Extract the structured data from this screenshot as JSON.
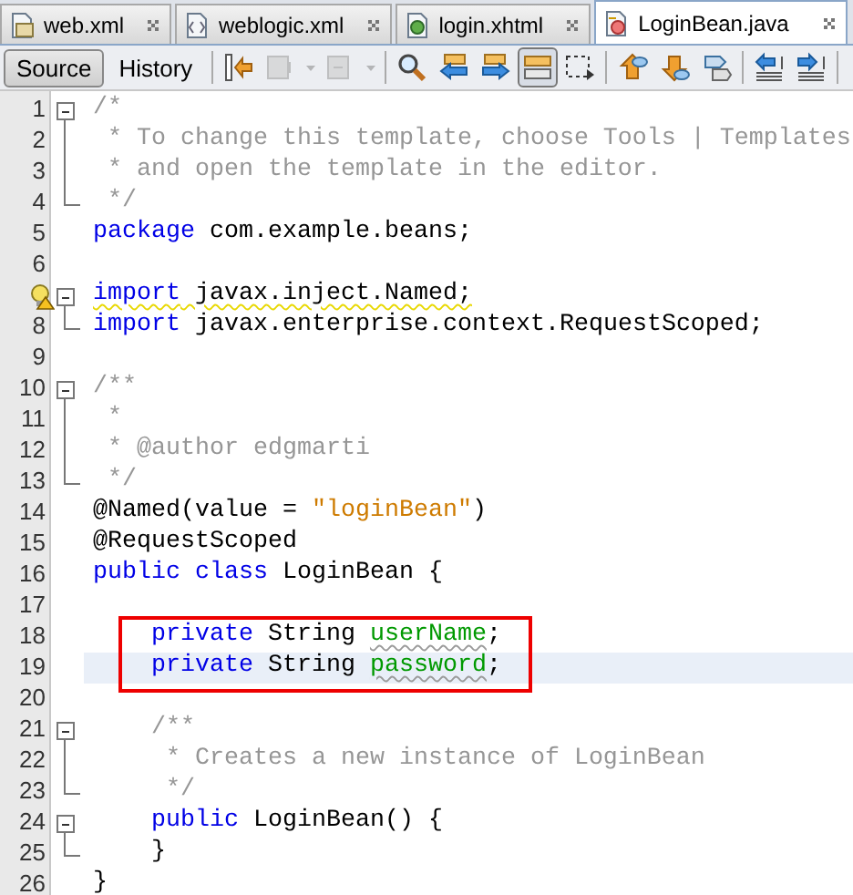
{
  "tabs": [
    {
      "kind": "xml",
      "label": "web.xml",
      "selected": false
    },
    {
      "kind": "config",
      "label": "weblogic.xml",
      "selected": false
    },
    {
      "kind": "page",
      "label": "login.xhtml",
      "selected": false
    },
    {
      "kind": "java",
      "label": "LoginBean.java",
      "selected": true
    }
  ],
  "view_buttons": [
    {
      "label": "Source",
      "selected": true
    },
    {
      "label": "History",
      "selected": false
    }
  ],
  "tools": [
    {
      "kind": "separator"
    },
    {
      "kind": "last-edit",
      "disabled": false,
      "selected": false
    },
    {
      "kind": "back",
      "disabled": true,
      "selected": false
    },
    {
      "kind": "dropdown",
      "disabled": true,
      "selected": false
    },
    {
      "kind": "forward",
      "disabled": true,
      "selected": false
    },
    {
      "kind": "dropdown",
      "disabled": true,
      "selected": false
    },
    {
      "kind": "separator"
    },
    {
      "kind": "find",
      "disabled": false,
      "selected": false
    },
    {
      "kind": "find-previous",
      "disabled": false,
      "selected": false
    },
    {
      "kind": "find-next",
      "disabled": false,
      "selected": false
    },
    {
      "kind": "highlight",
      "disabled": false,
      "selected": true
    },
    {
      "kind": "rect-select",
      "disabled": false,
      "selected": false
    },
    {
      "kind": "separator"
    },
    {
      "kind": "bookmark-previous",
      "disabled": false,
      "selected": false
    },
    {
      "kind": "bookmark-next",
      "disabled": false,
      "selected": false
    },
    {
      "kind": "bookmark-toggle",
      "disabled": false,
      "selected": false
    },
    {
      "kind": "separator"
    },
    {
      "kind": "shift-left",
      "disabled": false,
      "selected": false
    },
    {
      "kind": "shift-right",
      "disabled": false,
      "selected": false
    },
    {
      "kind": "separator"
    }
  ],
  "lines": [
    {
      "number": "1",
      "fold_start": true,
      "fold_end": false,
      "hint": false,
      "current": false,
      "boxed": false,
      "tokens": [
        {
          "kind": "comment",
          "text": "/*"
        }
      ]
    },
    {
      "number": "2",
      "fold_start": false,
      "fold_end": false,
      "hint": false,
      "current": false,
      "boxed": false,
      "tokens": [
        {
          "kind": "comment",
          "text": " * To change this template, choose Tools | Templates"
        }
      ]
    },
    {
      "number": "3",
      "fold_start": false,
      "fold_end": false,
      "hint": false,
      "current": false,
      "boxed": false,
      "tokens": [
        {
          "kind": "comment",
          "text": " * and open the template in the editor."
        }
      ]
    },
    {
      "number": "4",
      "fold_start": false,
      "fold_end": true,
      "hint": false,
      "current": false,
      "boxed": false,
      "tokens": [
        {
          "kind": "comment",
          "text": " */"
        }
      ]
    },
    {
      "number": "5",
      "fold_start": false,
      "fold_end": false,
      "hint": false,
      "current": false,
      "boxed": false,
      "tokens": [
        {
          "kind": "keyword",
          "text": "package"
        },
        {
          "kind": "plain",
          "text": " com.example.beans;"
        }
      ]
    },
    {
      "number": "6",
      "fold_start": false,
      "fold_end": false,
      "hint": false,
      "current": false,
      "boxed": false
    },
    {
      "fold_start": true,
      "fold_end": false,
      "hint": true,
      "current": false,
      "boxed": false,
      "tokens": [
        {
          "kind": "keyword",
          "text": "import"
        },
        {
          "kind": "plain",
          "text": " javax.inject.Named;"
        }
      ]
    },
    {
      "number": "8",
      "fold_start": false,
      "fold_end": true,
      "hint": false,
      "current": false,
      "boxed": false,
      "tokens": [
        {
          "kind": "keyword",
          "text": "import"
        },
        {
          "kind": "plain",
          "text": " javax.enterprise.context.RequestScoped;"
        }
      ]
    },
    {
      "number": "9",
      "fold_start": false,
      "fold_end": false,
      "hint": false,
      "current": false,
      "boxed": false
    },
    {
      "number": "10",
      "fold_start": true,
      "fold_end": false,
      "hint": false,
      "current": false,
      "boxed": false,
      "tokens": [
        {
          "kind": "comment",
          "text": "/**"
        }
      ]
    },
    {
      "number": "11",
      "fold_start": false,
      "fold_end": false,
      "hint": false,
      "current": false,
      "boxed": false,
      "tokens": [
        {
          "kind": "comment",
          "text": " *"
        }
      ]
    },
    {
      "number": "12",
      "fold_start": false,
      "fold_end": false,
      "hint": false,
      "current": false,
      "boxed": false,
      "tokens": [
        {
          "kind": "comment",
          "text": " * @author edgmarti"
        }
      ]
    },
    {
      "number": "13",
      "fold_start": false,
      "fold_end": true,
      "hint": false,
      "current": false,
      "boxed": false,
      "tokens": [
        {
          "kind": "comment",
          "text": " */"
        }
      ]
    },
    {
      "number": "14",
      "fold_start": false,
      "fold_end": false,
      "hint": false,
      "current": false,
      "boxed": false,
      "tokens": [
        {
          "kind": "plain",
          "text": "@Named(value = "
        },
        {
          "kind": "string",
          "text": "\"loginBean\""
        },
        {
          "kind": "plain",
          "text": ")"
        }
      ]
    },
    {
      "number": "15",
      "fold_start": false,
      "fold_end": false,
      "hint": false,
      "current": false,
      "boxed": false,
      "tokens": [
        {
          "kind": "plain",
          "text": "@RequestScoped"
        }
      ]
    },
    {
      "number": "16",
      "fold_start": false,
      "fold_end": false,
      "hint": false,
      "current": false,
      "boxed": false,
      "tokens": [
        {
          "kind": "keyword",
          "text": "public class"
        },
        {
          "kind": "plain",
          "text": " LoginBean {"
        }
      ]
    },
    {
      "number": "17",
      "fold_start": false,
      "fold_end": false,
      "hint": false,
      "current": false,
      "boxed": false
    },
    {
      "number": "18",
      "fold_start": false,
      "fold_end": false,
      "hint": false,
      "current": false,
      "boxed": true,
      "tokens": [
        {
          "kind": "keyword",
          "text": "    private"
        },
        {
          "kind": "plain",
          "text": " String "
        },
        {
          "kind": "field",
          "text": "userName"
        },
        {
          "kind": "plain",
          "text": ";"
        }
      ]
    },
    {
      "number": "19",
      "fold_start": false,
      "fold_end": false,
      "hint": false,
      "current": true,
      "boxed": true,
      "tokens": [
        {
          "kind": "keyword",
          "text": "    private"
        },
        {
          "kind": "plain",
          "text": " String "
        },
        {
          "kind": "field",
          "text": "password"
        },
        {
          "kind": "plain",
          "text": ";"
        }
      ]
    },
    {
      "number": "20",
      "fold_start": false,
      "fold_end": false,
      "hint": false,
      "current": false,
      "boxed": false
    },
    {
      "number": "21",
      "fold_start": true,
      "fold_end": false,
      "hint": false,
      "current": false,
      "boxed": false,
      "tokens": [
        {
          "kind": "comment",
          "text": "    /**"
        }
      ]
    },
    {
      "number": "22",
      "fold_start": false,
      "fold_end": false,
      "hint": false,
      "current": false,
      "boxed": false,
      "tokens": [
        {
          "kind": "comment",
          "text": "     * Creates a new instance of LoginBean"
        }
      ]
    },
    {
      "number": "23",
      "fold_start": false,
      "fold_end": true,
      "hint": false,
      "current": false,
      "boxed": false,
      "tokens": [
        {
          "kind": "comment",
          "text": "     */"
        }
      ]
    },
    {
      "number": "24",
      "fold_start": true,
      "fold_end": false,
      "hint": false,
      "current": false,
      "boxed": false,
      "tokens": [
        {
          "kind": "keyword",
          "text": "    public"
        },
        {
          "kind": "plain",
          "text": " LoginBean() {"
        }
      ]
    },
    {
      "number": "25",
      "fold_start": false,
      "fold_end": true,
      "hint": false,
      "current": false,
      "boxed": false,
      "tokens": [
        {
          "kind": "plain",
          "text": "    }"
        }
      ]
    },
    {
      "number": "26",
      "fold_start": false,
      "fold_end": false,
      "hint": false,
      "current": false,
      "boxed": false,
      "tokens": [
        {
          "kind": "plain",
          "text": "}"
        }
      ]
    }
  ]
}
